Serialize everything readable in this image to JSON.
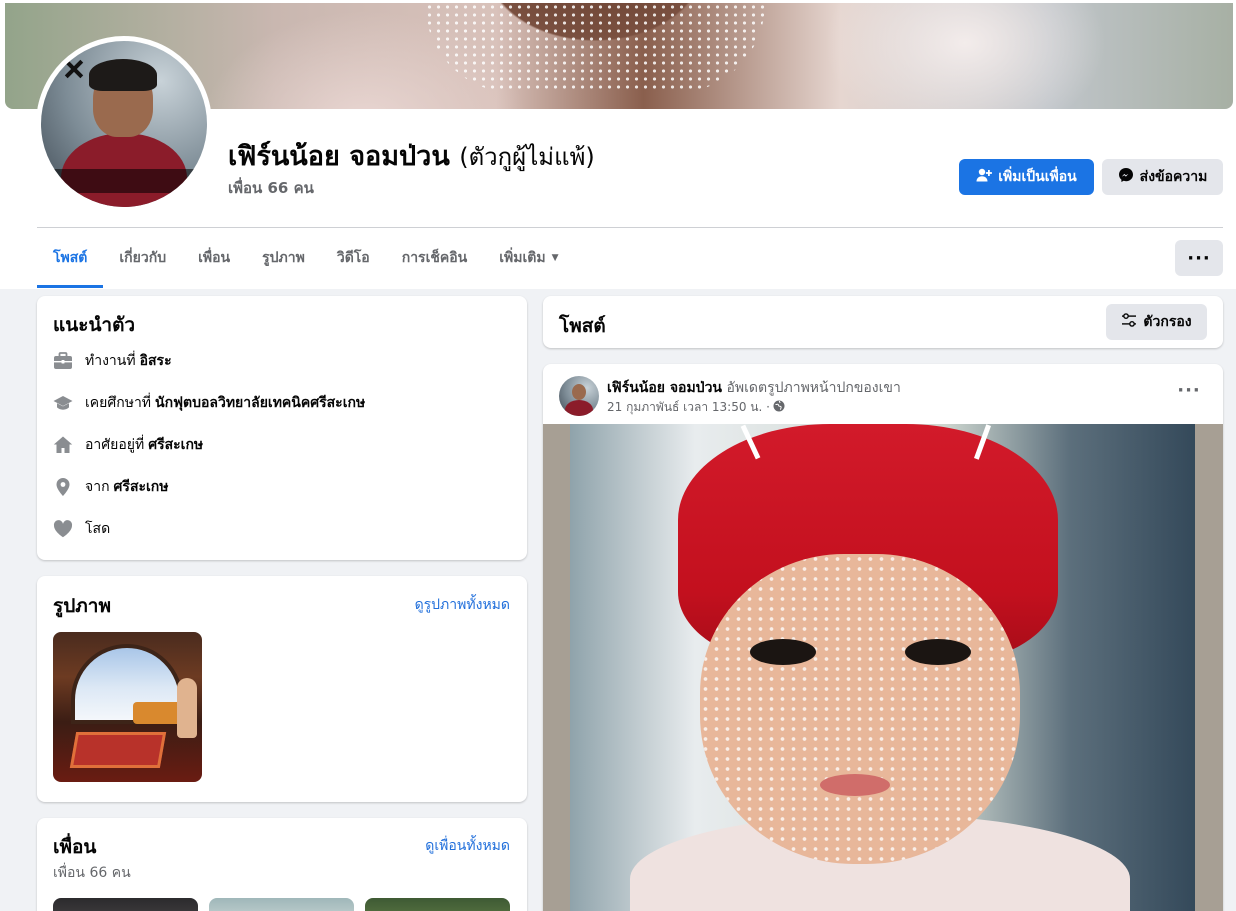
{
  "profile": {
    "name": "เฟิร์นน้อย จอมป่วน",
    "alternate_name": "(ตัวกูผู้ไม่แพ้)",
    "friends_count": "เพื่อน 66 คน",
    "add_friend_label": "เพิ่มเป็นเพื่อน",
    "message_label": "ส่งข้อความ"
  },
  "tabs": [
    {
      "label": "โพสต์"
    },
    {
      "label": "เกี่ยวกับ"
    },
    {
      "label": "เพื่อน"
    },
    {
      "label": "รูปภาพ"
    },
    {
      "label": "วิดีโอ"
    },
    {
      "label": "การเช็คอิน"
    },
    {
      "label": "เพิ่มเติม"
    }
  ],
  "more_button": "···",
  "intro": {
    "title": "แนะนำตัว",
    "rows": [
      {
        "icon": "briefcase-icon",
        "prefix": "ทำงานที่",
        "value": "อิสระ"
      },
      {
        "icon": "graduation-cap-icon",
        "prefix": "เคยศึกษาที่",
        "value": "นักฟุตบอลวิทยาลัยเทคนิคศรีสะเกษ"
      },
      {
        "icon": "home-icon",
        "prefix": "อาศัยอยู่ที่",
        "value": "ศรีสะเกษ"
      },
      {
        "icon": "location-pin-icon",
        "prefix": "จาก",
        "value": "ศรีสะเกษ"
      },
      {
        "icon": "heart-icon",
        "prefix": "โสด",
        "value": ""
      }
    ]
  },
  "photos": {
    "title": "รูปภาพ",
    "see_all": "ดูรูปภาพทั้งหมด"
  },
  "friends": {
    "title": "เพื่อน",
    "see_all": "ดูเพื่อนทั้งหมด",
    "count": "เพื่อน 66 คน"
  },
  "posts": {
    "title": "โพสต์",
    "filter_label": "ตัวกรอง"
  },
  "post": {
    "author": "เฟิร์นน้อย จอมป่วน",
    "action": "อัพเดตรูปภาพหน้าปกของเขา",
    "time": "21 กุมภาพันธ์ เวลา 13:50 น. ·",
    "more": "···"
  },
  "colors": {
    "accent": "#1b74e4",
    "link": "#216fdb",
    "secondary_text": "#65676b",
    "page_bg": "#f0f2f5"
  }
}
